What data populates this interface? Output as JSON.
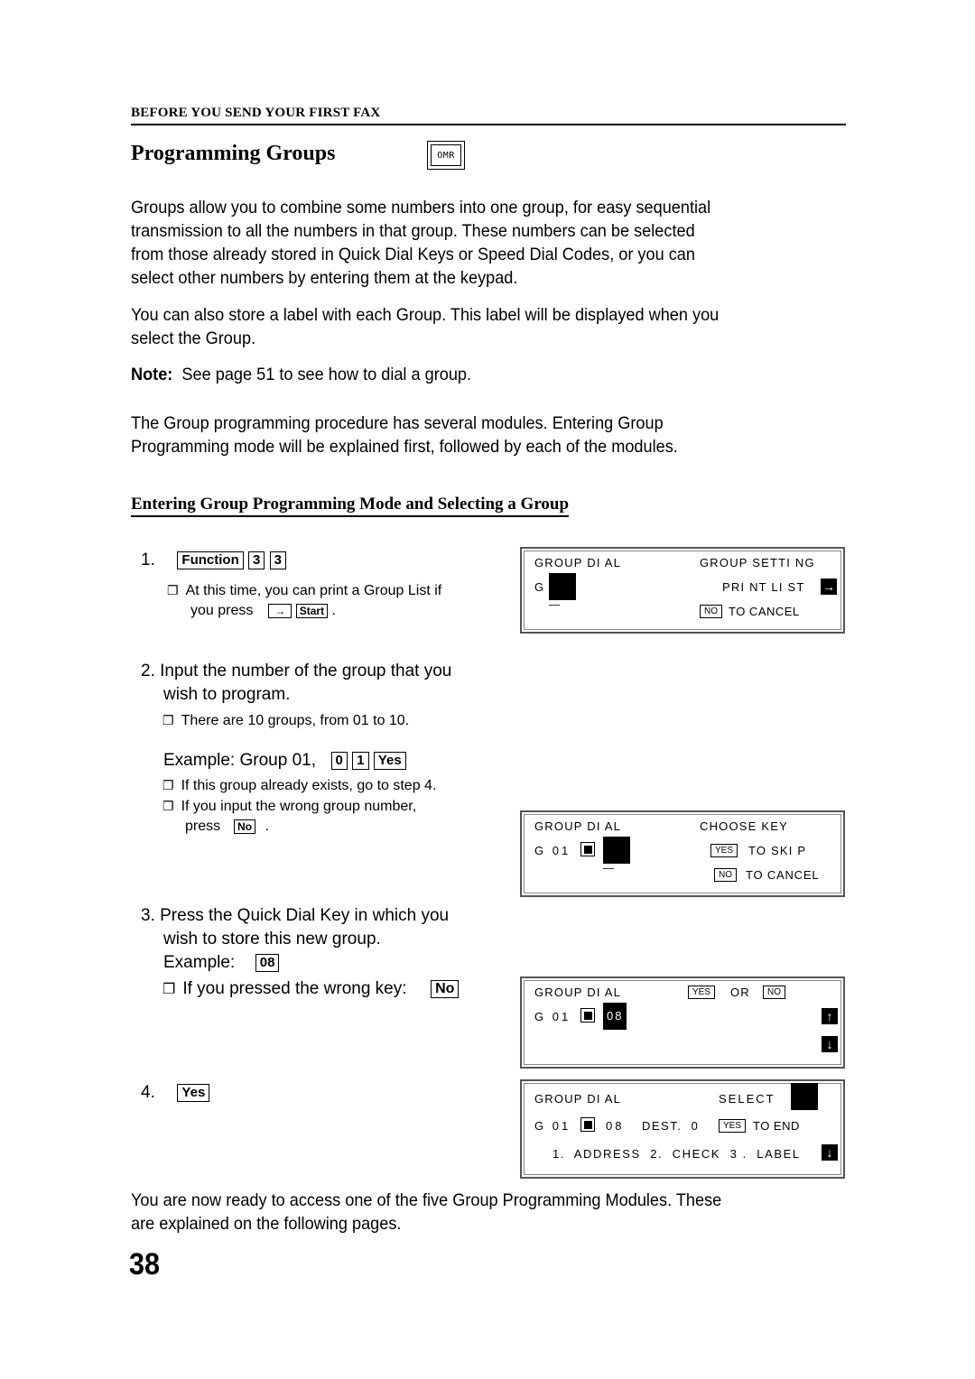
{
  "header": {
    "section": "BEFORE YOU SEND YOUR FIRST FAX",
    "title": "Programming Groups",
    "badge": "OMR"
  },
  "intro": {
    "p1": [
      "Groups allow you to combine some numbers into one group, for easy sequential",
      "transmission to all the numbers in that group. These numbers can be selected",
      "from those already stored in Quick Dial Keys or Speed Dial Codes, or you can",
      "select other numbers by entering them at the keypad."
    ],
    "p2": [
      "You can also store a label with each Group. This label will be displayed when you",
      "select the Group."
    ],
    "note_label": "Note:",
    "note_text": "See page 51 to see how to dial a group.",
    "p3": [
      "The Group programming procedure has several modules. Entering Group",
      "Programming mode will be explained first, followed by each of the modules."
    ]
  },
  "subheading": "Entering Group Programming Mode and Selecting a Group",
  "steps": {
    "s1": {
      "num": "1.",
      "keys": [
        "Function",
        "3",
        "3"
      ],
      "note_a": "At this time, you can print a Group List if",
      "note_b": "you press",
      "note_keys": [
        "→",
        "Start"
      ],
      "note_end": "."
    },
    "s2": {
      "line1": "2. Input the number of the group that you",
      "line2": "wish to program.",
      "note": "There are 10 groups, from 01 to 10.",
      "example": "Example: Group 01,",
      "keys": [
        "0",
        "1",
        "Yes"
      ],
      "note2": "If this group already exists, go to step 4.",
      "note3": "If you input the wrong group number,",
      "note3b": "press",
      "note3_key": "No",
      "note3_end": "."
    },
    "s3": {
      "line1": "3. Press the Quick Dial Key in which you",
      "line2": "wish to store this new group.",
      "example": "Example:",
      "example_key": "08",
      "note": "If you pressed the wrong key:",
      "note_key": "No"
    },
    "s4": {
      "num": "4.",
      "key": "Yes"
    }
  },
  "bullet_glyph": "❐",
  "lcd1": {
    "left_title": "GROUP DI AL",
    "right_title": "GROUP SETTI NG",
    "g_label": "G",
    "print": "PRI NT LI ST",
    "arrow": "→",
    "no_key": "NO",
    "cancel": "TO CANCEL"
  },
  "lcd2": {
    "left_title": "GROUP DI AL",
    "right_title": "CHOOSE KEY",
    "g_label": "G 01",
    "yes_key": "YES",
    "skip": "TO SKI P",
    "no_key": "NO",
    "cancel": "TO CANCEL"
  },
  "lcd3": {
    "left_title": "GROUP DI AL",
    "yes_key": "YES",
    "or": "OR",
    "no_key": "NO",
    "g_label": "G 01",
    "value": "08",
    "up": "↑",
    "down": "↓"
  },
  "lcd4": {
    "left_title": "GROUP DI AL",
    "select": "SELECT",
    "g_label": "G 01",
    "value": "08",
    "dest": "DEST.  0",
    "yes_key": "YES",
    "end": "TO END",
    "menu": "1.  ADDRESS  2.  CHECK  3 .  LABEL",
    "down": "↓"
  },
  "closing": [
    "You are now ready to access one of the five Group Programming Modules. These",
    "are explained on the following pages."
  ],
  "page_number": "38"
}
